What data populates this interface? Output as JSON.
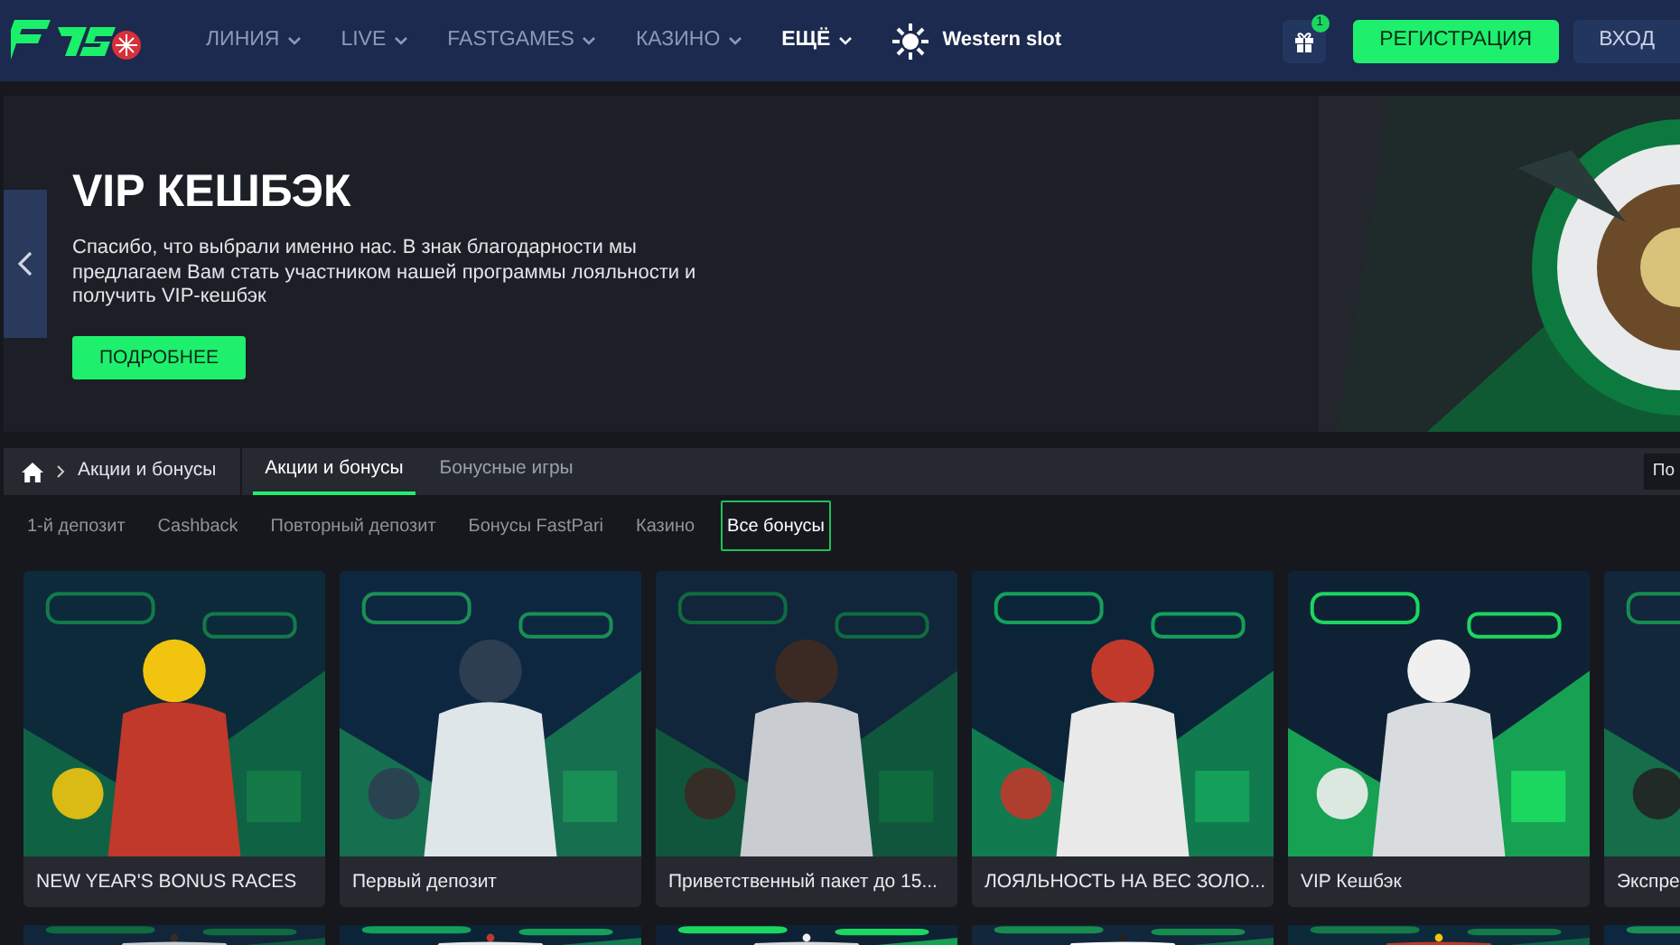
{
  "header": {
    "nav": [
      {
        "label": "ЛИНИЯ",
        "dropdown": true,
        "selected": false
      },
      {
        "label": "LIVE",
        "dropdown": true,
        "selected": false
      },
      {
        "label": "FASTGAMES",
        "dropdown": true,
        "selected": false
      },
      {
        "label": "КАЗИНО",
        "dropdown": true,
        "selected": false
      },
      {
        "label": "ЕЩЁ",
        "dropdown": true,
        "selected": true
      }
    ],
    "promo": "Western slot",
    "gift_count": "1",
    "register": "РЕГИСТРАЦИЯ",
    "login": "ВХОД"
  },
  "banner": {
    "title": "VIP КЕШБЭК",
    "text": "Спасибо, что выбрали именно нас. В знак благодарности мы предлагаем Вам стать участником нашей программы лояльности и получить VIP-кешбэк",
    "button": "ПОДРОБНЕЕ"
  },
  "breadcrumb": "Акции и бонусы",
  "tabs": [
    {
      "label": "Акции и бонусы",
      "selected": true
    },
    {
      "label": "Бонусные игры",
      "selected": false
    }
  ],
  "right_button": "По",
  "filters": [
    {
      "label": "1-й депозит",
      "selected": false
    },
    {
      "label": "Cashback",
      "selected": false
    },
    {
      "label": "Повторный депозит",
      "selected": false
    },
    {
      "label": "Бонусы FastPari",
      "selected": false
    },
    {
      "label": "Казино",
      "selected": false
    },
    {
      "label": "Все бонусы",
      "selected": true
    }
  ],
  "cards": [
    {
      "title": "NEW YEAR'S BONUS RACES"
    },
    {
      "title": "Первый депозит"
    },
    {
      "title": "Приветственный пакет до 15..."
    },
    {
      "title": "ЛОЯЛЬНОСТЬ НА ВЕС ЗОЛО..."
    },
    {
      "title": "VIP Кешбэк"
    },
    {
      "title": "Экспре"
    }
  ]
}
